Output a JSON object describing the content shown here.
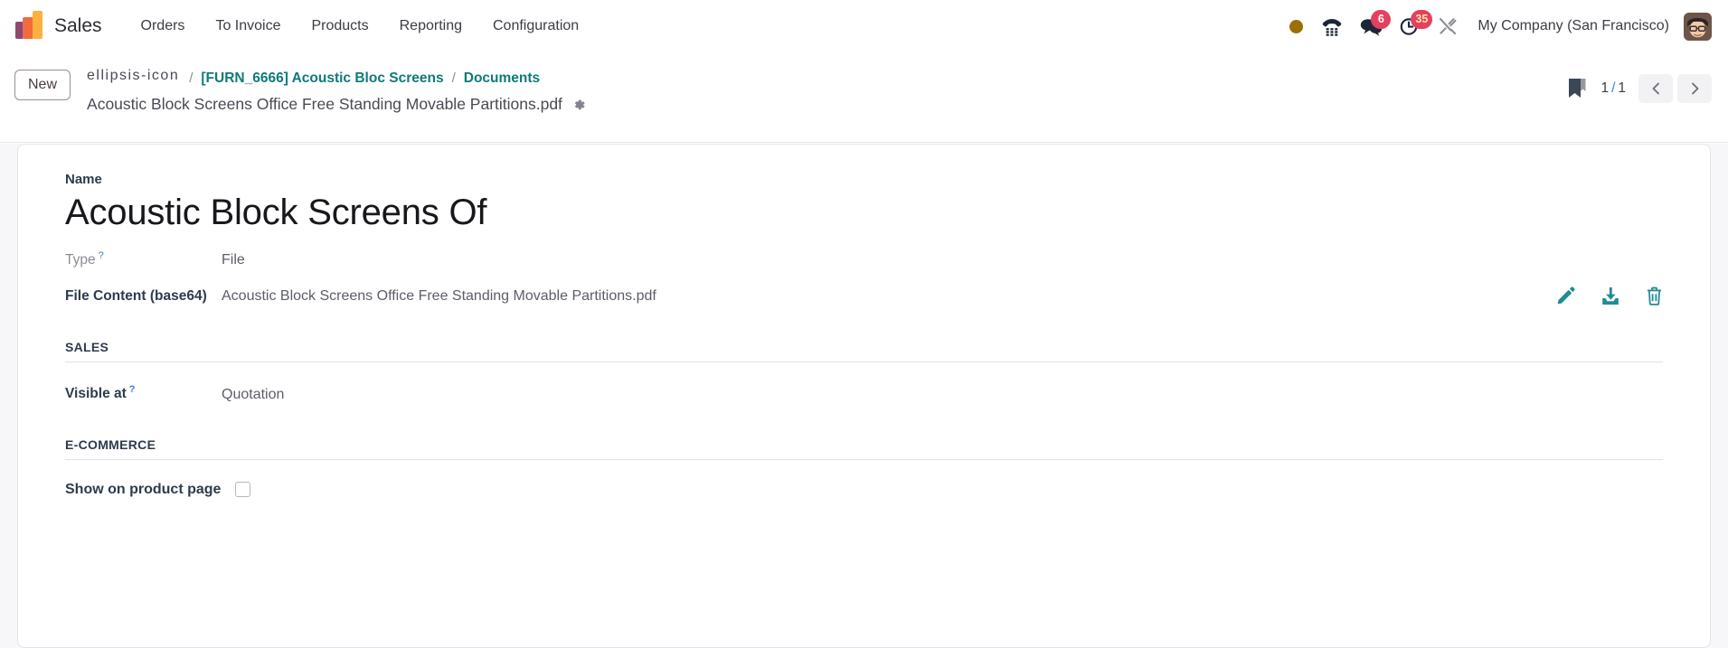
{
  "navbar": {
    "brand": "Sales",
    "logo_icon": "sales-bar-chart-logo",
    "menu": [
      {
        "label": "Orders"
      },
      {
        "label": "To Invoice"
      },
      {
        "label": "Products"
      },
      {
        "label": "Reporting"
      },
      {
        "label": "Configuration"
      }
    ],
    "systray": {
      "status_dot": {
        "icon": "status-dot-icon",
        "color": "#9a7007"
      },
      "phone": {
        "icon": "phone-dialpad-icon"
      },
      "messages": {
        "icon": "chat-bubble-icon",
        "count": "6"
      },
      "activities": {
        "icon": "clock-activity-icon",
        "count": "35"
      },
      "tools": {
        "icon": "wrench-screwdriver-icon"
      }
    },
    "company": "My Company (San Francisco)",
    "avatar_icon": "user-avatar"
  },
  "control_panel": {
    "new_label": "New",
    "breadcrumb": {
      "overflow_icon": "ellipsis-icon",
      "separator": "/",
      "items": [
        {
          "label": "[FURN_6666] Acoustic Bloc Screens"
        },
        {
          "label": "Documents"
        }
      ],
      "record_title": "Acoustic Block Screens Office Free Standing Movable Partitions.pdf",
      "settings_icon": "gear-icon"
    },
    "pager": {
      "bookmark_icon": "bookmark-icon",
      "current": "1",
      "separator": "/",
      "total": "1",
      "prev_icon": "chevron-left-icon",
      "next_icon": "chevron-right-icon"
    }
  },
  "form": {
    "name_label": "Name",
    "name_value": "Acoustic Block Screens Of",
    "type_label": "Type",
    "type_help": "?",
    "type_value": "File",
    "file_content_label": "File Content (base64)",
    "file_content_value": "Acoustic Block Screens Office Free Standing Movable Partitions.pdf",
    "file_actions": {
      "edit_icon": "pencil-edit-icon",
      "download_icon": "download-icon",
      "delete_icon": "trash-delete-icon",
      "color": "#1f8c96"
    },
    "sales_section": {
      "title": "SALES",
      "visible_at_label": "Visible at",
      "visible_at_help": "?",
      "visible_at_value": "Quotation"
    },
    "ecommerce_section": {
      "title": "E-COMMERCE",
      "show_on_product_page_label": "Show on product page",
      "show_on_product_page_checked": false
    }
  }
}
